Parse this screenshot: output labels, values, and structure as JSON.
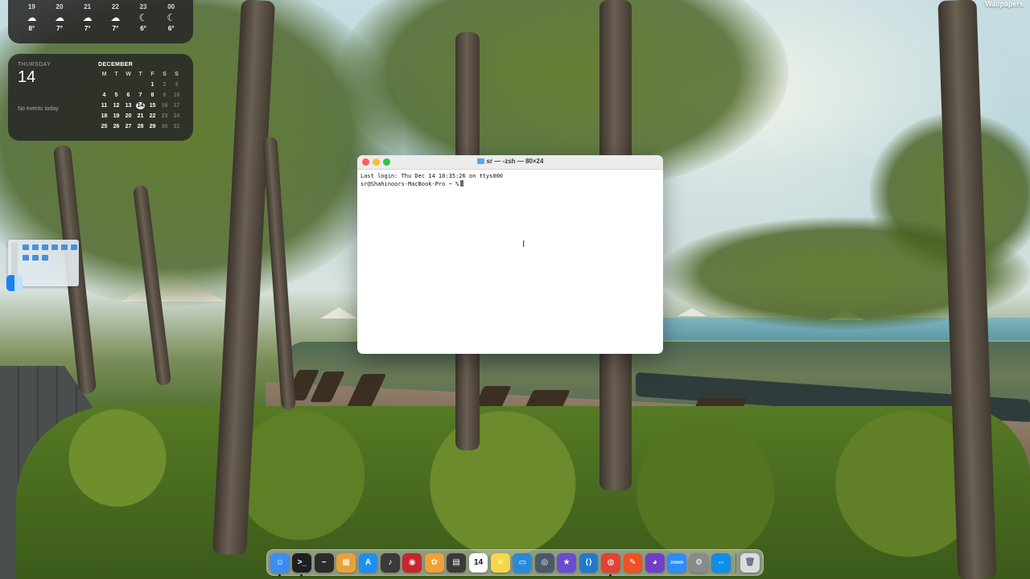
{
  "wallpaper_label": "Wallpapers",
  "weather": {
    "hours": [
      {
        "hour": "19",
        "icon": "cloud-moon-icon",
        "glyph": "☁",
        "temp": "8°"
      },
      {
        "hour": "20",
        "icon": "cloud-moon-icon",
        "glyph": "☁",
        "temp": "7°"
      },
      {
        "hour": "21",
        "icon": "cloud-moon-icon",
        "glyph": "☁",
        "temp": "7°"
      },
      {
        "hour": "22",
        "icon": "cloud-moon-icon",
        "glyph": "☁",
        "temp": "7°"
      },
      {
        "hour": "23",
        "icon": "moon-icon",
        "glyph": "☾",
        "temp": "6°"
      },
      {
        "hour": "00",
        "icon": "moon-icon",
        "glyph": "☾",
        "temp": "6°"
      }
    ]
  },
  "calendar": {
    "weekday": "THURSDAY",
    "day": "14",
    "events": "No events today",
    "month": "DECEMBER",
    "headers": [
      "M",
      "T",
      "W",
      "T",
      "F",
      "S",
      "S"
    ],
    "days": [
      "",
      "",
      "",
      "",
      "1",
      "2",
      "3",
      "4",
      "5",
      "6",
      "7",
      "8",
      "9",
      "10",
      "11",
      "12",
      "13",
      "14",
      "15",
      "16",
      "17",
      "18",
      "19",
      "20",
      "21",
      "22",
      "23",
      "24",
      "25",
      "26",
      "27",
      "28",
      "29",
      "30",
      "31"
    ],
    "today": "14"
  },
  "terminal": {
    "title": "sr — -zsh — 80×24",
    "line1": "Last login: Thu Dec 14 18:35:26 on ttys000",
    "prompt": "sr@Shahinoors-MacBook-Pro ~ %"
  },
  "dock": {
    "apps": [
      {
        "name": "finder-icon",
        "glyph": "☺",
        "color": "#3a8ef0",
        "running": true
      },
      {
        "name": "terminal-app-icon",
        "glyph": ">_",
        "color": "#1e1e1e",
        "running": true
      },
      {
        "name": "activity-monitor-icon",
        "glyph": "~",
        "color": "#2b2b2b",
        "running": false
      },
      {
        "name": "launchpad-icon",
        "glyph": "▦",
        "color": "#e8a23a",
        "running": false
      },
      {
        "name": "app-store-icon",
        "glyph": "A",
        "color": "#1f8ef1",
        "running": false
      },
      {
        "name": "garageband-icon",
        "glyph": "♪",
        "color": "#3a3a3a",
        "running": false
      },
      {
        "name": "photo-booth-icon",
        "glyph": "◉",
        "color": "#c6262e",
        "running": false
      },
      {
        "name": "photos-icon",
        "glyph": "✿",
        "color": "#f2a035",
        "running": false
      },
      {
        "name": "calculator-icon",
        "glyph": "▤",
        "color": "#3a3a3a",
        "running": false
      },
      {
        "name": "calendar-app-icon",
        "glyph": "14",
        "color": "#ffffff",
        "running": false,
        "calendar": true
      },
      {
        "name": "notes-icon",
        "glyph": "≡",
        "color": "#f6d64b",
        "running": false
      },
      {
        "name": "keynote-icon",
        "glyph": "▭",
        "color": "#2b8ad8",
        "running": false
      },
      {
        "name": "quicktime-icon",
        "glyph": "◎",
        "color": "#4a5a6a",
        "running": false
      },
      {
        "name": "imovie-icon",
        "glyph": "★",
        "color": "#6b4bd1",
        "running": false
      },
      {
        "name": "vscode-icon",
        "glyph": "⟨⟩",
        "color": "#2478cc",
        "running": false
      },
      {
        "name": "chrome-icon",
        "glyph": "◍",
        "color": "#e34133",
        "running": true
      },
      {
        "name": "pencil-app-icon",
        "glyph": "✎",
        "color": "#f25022",
        "running": false
      },
      {
        "name": "github-desktop-icon",
        "glyph": "◕",
        "color": "#6e40c9",
        "running": false
      },
      {
        "name": "zoom-icon",
        "glyph": "zoom",
        "color": "#2d8cff",
        "running": false
      },
      {
        "name": "system-settings-icon",
        "glyph": "⚙",
        "color": "#8a8a8a",
        "running": false
      },
      {
        "name": "teamviewer-icon",
        "glyph": "⇔",
        "color": "#0e8ee9",
        "running": false
      }
    ],
    "trash": {
      "name": "trash-icon",
      "glyph": "🗑",
      "color": "#d9dde2"
    }
  }
}
